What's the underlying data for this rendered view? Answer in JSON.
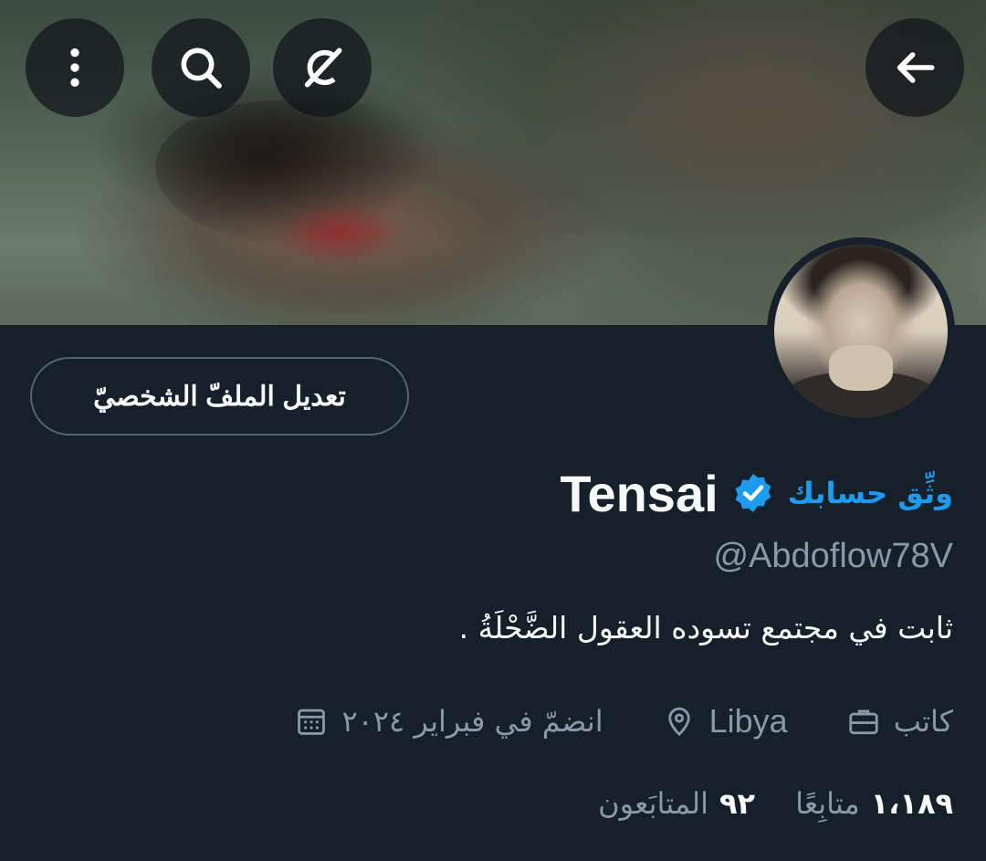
{
  "header": {
    "buttons": {
      "back": "arrow-left-icon",
      "grok": "grok-icon",
      "search": "search-icon",
      "more": "more-vertical-icon"
    }
  },
  "profile": {
    "edit_button_label": "تعديل الملفّ الشخصيّ",
    "display_name": "Tensai",
    "verify_link": "وثِّق حسابك",
    "handle": "@Abdoflow78V",
    "bio": "ثابت في مجتمع تسوده العقول الضَّحْلَةُ .",
    "meta": {
      "profession": "كاتب",
      "location": "Libya",
      "joined": "انضمّ في فبراير ٢٠٢٤"
    },
    "stats": {
      "following_count": "٩٢",
      "following_label": "المتابَعون",
      "followers_count": "١،١٨٩",
      "followers_label": "متابِعًا"
    }
  },
  "colors": {
    "background": "#15202b",
    "accent": "#1d9bf0",
    "muted_text": "#8b98a5",
    "primary_text": "#f7f9f9"
  }
}
